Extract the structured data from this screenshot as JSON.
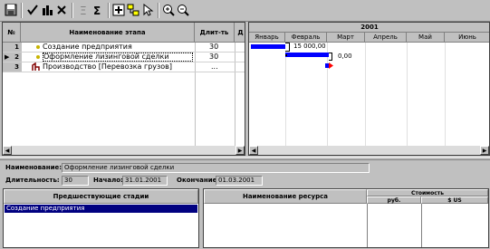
{
  "grid": {
    "columns": {
      "num": "№",
      "name": "Наименование этапа",
      "duration": "Длит-ть",
      "extra": "Д"
    },
    "rows": [
      {
        "num": "1",
        "name": "Создание предприятия",
        "duration": "30",
        "icon": "bullet-icon"
      },
      {
        "num": "2",
        "name": "Оформление лизинговой сделки",
        "duration": "30",
        "icon": "bullet-icon",
        "current": "▶"
      },
      {
        "num": "3",
        "name": "Производство [Перевозка грузов]",
        "duration": "...",
        "icon": "production-icon"
      }
    ]
  },
  "gantt": {
    "year": "2001",
    "months": [
      "Январь",
      "Февраль",
      "Март",
      "Апрель",
      "Май",
      "Июнь"
    ],
    "bar_labels": [
      "15 000,00",
      "0,00"
    ],
    "colors": {
      "bar": "#0000ff",
      "milestone": "#ff0000"
    }
  },
  "details": {
    "name_label": "Наименование:",
    "name_value": "Оформление лизинговой сделки",
    "duration_label": "Длительность:",
    "duration_value": "30",
    "start_label": "Начало:",
    "start_value": "31.01.2001",
    "end_label": "Окончание:",
    "end_value": "01.03.2001"
  },
  "predecessors": {
    "header": "Предшествующие стадии",
    "items": [
      "Создание предприятия"
    ]
  },
  "resources": {
    "header_name": "Наименование ресурса",
    "header_cost": "Стоимость",
    "header_rub": "руб.",
    "header_usd": "$ US"
  },
  "colors": {
    "selection": "#000080",
    "background": "#c0c0c0"
  }
}
